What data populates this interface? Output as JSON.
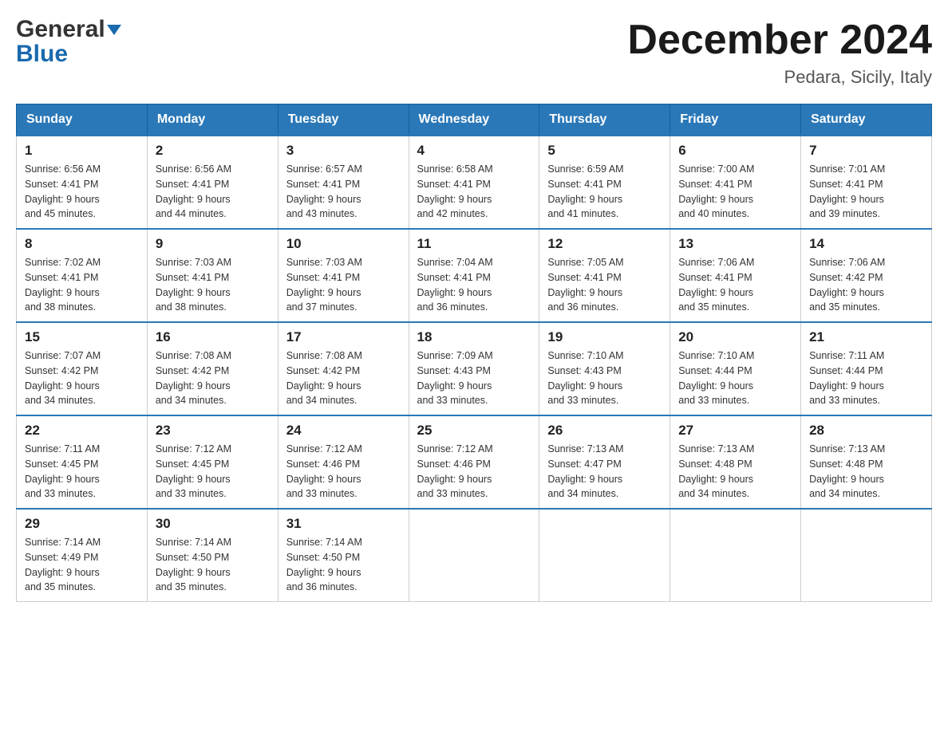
{
  "header": {
    "logo_general": "General",
    "logo_blue": "Blue",
    "month_title": "December 2024",
    "location": "Pedara, Sicily, Italy"
  },
  "days_of_week": [
    "Sunday",
    "Monday",
    "Tuesday",
    "Wednesday",
    "Thursday",
    "Friday",
    "Saturday"
  ],
  "weeks": [
    [
      {
        "day": "1",
        "sunrise": "6:56 AM",
        "sunset": "4:41 PM",
        "daylight": "9 hours and 45 minutes."
      },
      {
        "day": "2",
        "sunrise": "6:56 AM",
        "sunset": "4:41 PM",
        "daylight": "9 hours and 44 minutes."
      },
      {
        "day": "3",
        "sunrise": "6:57 AM",
        "sunset": "4:41 PM",
        "daylight": "9 hours and 43 minutes."
      },
      {
        "day": "4",
        "sunrise": "6:58 AM",
        "sunset": "4:41 PM",
        "daylight": "9 hours and 42 minutes."
      },
      {
        "day": "5",
        "sunrise": "6:59 AM",
        "sunset": "4:41 PM",
        "daylight": "9 hours and 41 minutes."
      },
      {
        "day": "6",
        "sunrise": "7:00 AM",
        "sunset": "4:41 PM",
        "daylight": "9 hours and 40 minutes."
      },
      {
        "day": "7",
        "sunrise": "7:01 AM",
        "sunset": "4:41 PM",
        "daylight": "9 hours and 39 minutes."
      }
    ],
    [
      {
        "day": "8",
        "sunrise": "7:02 AM",
        "sunset": "4:41 PM",
        "daylight": "9 hours and 38 minutes."
      },
      {
        "day": "9",
        "sunrise": "7:03 AM",
        "sunset": "4:41 PM",
        "daylight": "9 hours and 38 minutes."
      },
      {
        "day": "10",
        "sunrise": "7:03 AM",
        "sunset": "4:41 PM",
        "daylight": "9 hours and 37 minutes."
      },
      {
        "day": "11",
        "sunrise": "7:04 AM",
        "sunset": "4:41 PM",
        "daylight": "9 hours and 36 minutes."
      },
      {
        "day": "12",
        "sunrise": "7:05 AM",
        "sunset": "4:41 PM",
        "daylight": "9 hours and 36 minutes."
      },
      {
        "day": "13",
        "sunrise": "7:06 AM",
        "sunset": "4:41 PM",
        "daylight": "9 hours and 35 minutes."
      },
      {
        "day": "14",
        "sunrise": "7:06 AM",
        "sunset": "4:42 PM",
        "daylight": "9 hours and 35 minutes."
      }
    ],
    [
      {
        "day": "15",
        "sunrise": "7:07 AM",
        "sunset": "4:42 PM",
        "daylight": "9 hours and 34 minutes."
      },
      {
        "day": "16",
        "sunrise": "7:08 AM",
        "sunset": "4:42 PM",
        "daylight": "9 hours and 34 minutes."
      },
      {
        "day": "17",
        "sunrise": "7:08 AM",
        "sunset": "4:42 PM",
        "daylight": "9 hours and 34 minutes."
      },
      {
        "day": "18",
        "sunrise": "7:09 AM",
        "sunset": "4:43 PM",
        "daylight": "9 hours and 33 minutes."
      },
      {
        "day": "19",
        "sunrise": "7:10 AM",
        "sunset": "4:43 PM",
        "daylight": "9 hours and 33 minutes."
      },
      {
        "day": "20",
        "sunrise": "7:10 AM",
        "sunset": "4:44 PM",
        "daylight": "9 hours and 33 minutes."
      },
      {
        "day": "21",
        "sunrise": "7:11 AM",
        "sunset": "4:44 PM",
        "daylight": "9 hours and 33 minutes."
      }
    ],
    [
      {
        "day": "22",
        "sunrise": "7:11 AM",
        "sunset": "4:45 PM",
        "daylight": "9 hours and 33 minutes."
      },
      {
        "day": "23",
        "sunrise": "7:12 AM",
        "sunset": "4:45 PM",
        "daylight": "9 hours and 33 minutes."
      },
      {
        "day": "24",
        "sunrise": "7:12 AM",
        "sunset": "4:46 PM",
        "daylight": "9 hours and 33 minutes."
      },
      {
        "day": "25",
        "sunrise": "7:12 AM",
        "sunset": "4:46 PM",
        "daylight": "9 hours and 33 minutes."
      },
      {
        "day": "26",
        "sunrise": "7:13 AM",
        "sunset": "4:47 PM",
        "daylight": "9 hours and 34 minutes."
      },
      {
        "day": "27",
        "sunrise": "7:13 AM",
        "sunset": "4:48 PM",
        "daylight": "9 hours and 34 minutes."
      },
      {
        "day": "28",
        "sunrise": "7:13 AM",
        "sunset": "4:48 PM",
        "daylight": "9 hours and 34 minutes."
      }
    ],
    [
      {
        "day": "29",
        "sunrise": "7:14 AM",
        "sunset": "4:49 PM",
        "daylight": "9 hours and 35 minutes."
      },
      {
        "day": "30",
        "sunrise": "7:14 AM",
        "sunset": "4:50 PM",
        "daylight": "9 hours and 35 minutes."
      },
      {
        "day": "31",
        "sunrise": "7:14 AM",
        "sunset": "4:50 PM",
        "daylight": "9 hours and 36 minutes."
      },
      null,
      null,
      null,
      null
    ]
  ],
  "labels": {
    "sunrise": "Sunrise:",
    "sunset": "Sunset:",
    "daylight": "Daylight:"
  }
}
